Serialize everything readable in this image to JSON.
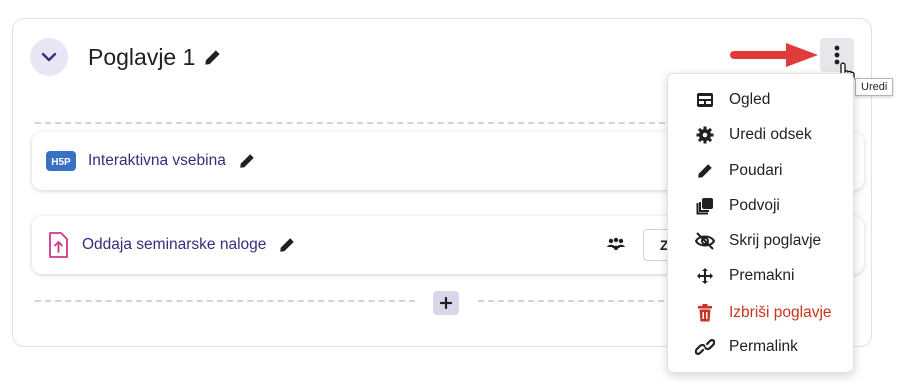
{
  "section": {
    "title": "Poglavje 1"
  },
  "tooltip": "Uredi",
  "activities": [
    {
      "name": "Interaktivna vsebina",
      "icon": "h5p-icon"
    },
    {
      "name": "Oddaja seminarske naloge",
      "icon": "assignment-upload-icon",
      "button_partial": "Z"
    }
  ],
  "menu": {
    "items": [
      {
        "label": "Ogled",
        "icon": "view-icon"
      },
      {
        "label": "Uredi odsek",
        "icon": "gear-icon"
      },
      {
        "label": "Poudari",
        "icon": "highlight-pen-icon"
      },
      {
        "label": "Podvoji",
        "icon": "duplicate-icon"
      },
      {
        "label": "Skrij poglavje",
        "icon": "eye-slash-icon"
      },
      {
        "label": "Premakni",
        "icon": "move-icon"
      },
      {
        "label": "Izbriši poglavje",
        "icon": "trash-icon",
        "color": "#ca3120"
      },
      {
        "label": "Permalink",
        "icon": "link-icon"
      }
    ]
  },
  "colors": {
    "accent": "#3d2a7d",
    "danger": "#ca3120",
    "arrow": "#e03a3a"
  }
}
